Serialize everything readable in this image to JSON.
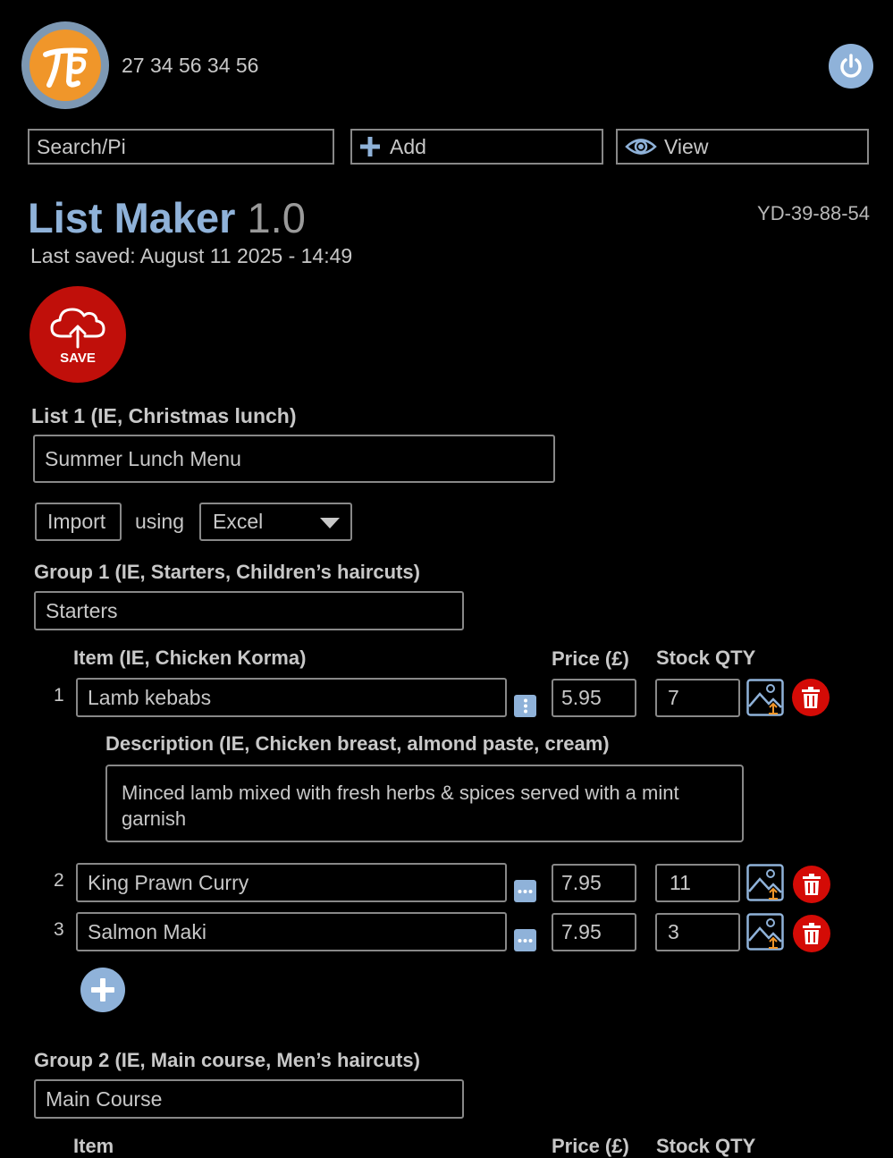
{
  "header": {
    "phone": "27 34 56 34 56"
  },
  "toolbar": {
    "search_placeholder": "Search/Pi",
    "add_label": "Add",
    "view_label": "View"
  },
  "app": {
    "title": "List Maker",
    "version": "1.0",
    "code": "YD-39-88-54",
    "last_saved": "Last saved: August 11 2025 - 14:49",
    "save_label": "SAVE"
  },
  "list": {
    "label": "List 1 (IE, Christmas lunch)",
    "value": "Summer Lunch Menu"
  },
  "import": {
    "button_label": "Import",
    "using_label": "using",
    "format_selected": "Excel"
  },
  "group1": {
    "label": "Group 1 (IE, Starters, Children’s haircuts)",
    "value": "Starters",
    "item_header": "Item (IE, Chicken Korma)",
    "price_header": "Price (£)",
    "stock_header": "Stock QTY",
    "description_label": "Description (IE, Chicken breast, almond paste, cream)",
    "description_value": "Minced lamb mixed with fresh herbs & spices served with a mint garnish",
    "items": [
      {
        "num": "1",
        "name": "Lamb kebabs",
        "price": "5.95",
        "stock": "7"
      },
      {
        "num": "2",
        "name": "King Prawn Curry",
        "price": "7.95",
        "stock": "11"
      },
      {
        "num": "3",
        "name": "Salmon Maki",
        "price": "7.95",
        "stock": "3"
      }
    ]
  },
  "group2": {
    "label": "Group 2 (IE, Main course, Men’s haircuts)",
    "value": "Main Course",
    "item_header": "Item",
    "price_header": "Price (£)",
    "stock_header": "Stock QTY"
  },
  "colors": {
    "accent_blue": "#8fb2d9",
    "save_red": "#c00f0a",
    "logo_orange": "#f0962a"
  }
}
